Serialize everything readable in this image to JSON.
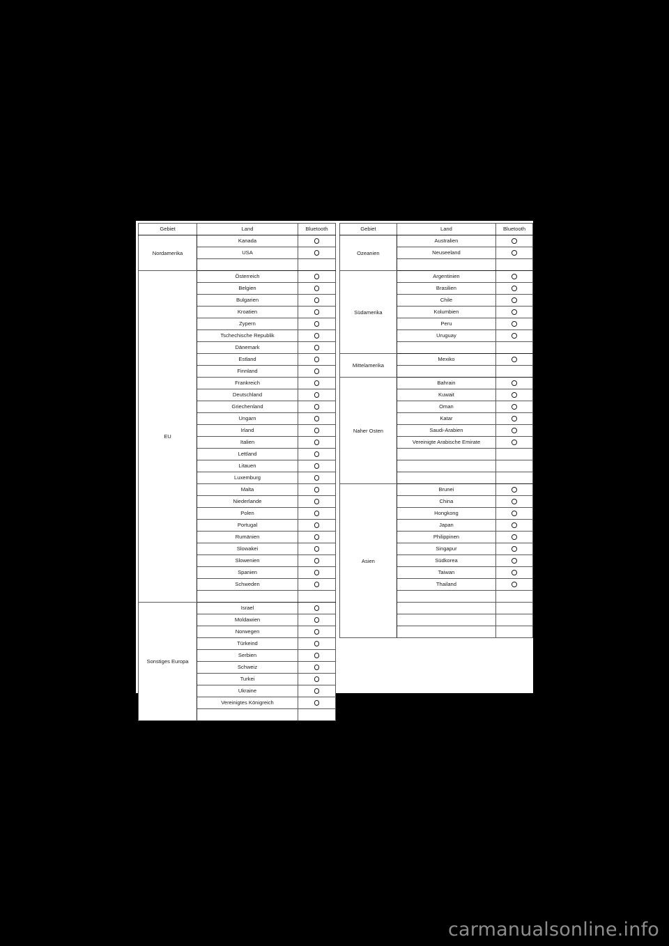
{
  "document": {
    "watermark": "carmanualsonline.info",
    "background_color": "#000000",
    "page_color": "#ffffff",
    "rule_color": "#1a1a1a"
  },
  "tables": [
    {
      "id": "left",
      "headers": [
        "Gebiet",
        "Land",
        "Bluetooth"
      ],
      "groups": [
        {
          "region": "Nordamerika",
          "rows": [
            {
              "country": "Kanada",
              "bluetooth": "O"
            },
            {
              "country": "USA",
              "bluetooth": "O"
            },
            {
              "country": "",
              "bluetooth": ""
            }
          ]
        },
        {
          "region": "EU",
          "rows": [
            {
              "country": "Österreich",
              "bluetooth": "O"
            },
            {
              "country": "Belgien",
              "bluetooth": "O"
            },
            {
              "country": "Bulgarien",
              "bluetooth": "O"
            },
            {
              "country": "Kroatien",
              "bluetooth": "O"
            },
            {
              "country": "Zypern",
              "bluetooth": "O"
            },
            {
              "country": "Tschechische Republik",
              "bluetooth": "O"
            },
            {
              "country": "Dänemark",
              "bluetooth": "O"
            },
            {
              "country": "Estland",
              "bluetooth": "O"
            },
            {
              "country": "Finnland",
              "bluetooth": "O"
            },
            {
              "country": "Frankreich",
              "bluetooth": "O"
            },
            {
              "country": "Deutschland",
              "bluetooth": "O"
            },
            {
              "country": "Griechenland",
              "bluetooth": "O"
            },
            {
              "country": "Ungarn",
              "bluetooth": "O"
            },
            {
              "country": "Irland",
              "bluetooth": "O"
            },
            {
              "country": "Italien",
              "bluetooth": "O"
            },
            {
              "country": "Lettland",
              "bluetooth": "O"
            },
            {
              "country": "Litauen",
              "bluetooth": "O"
            },
            {
              "country": "Luxemburg",
              "bluetooth": "O"
            },
            {
              "country": "Malta",
              "bluetooth": "O"
            },
            {
              "country": "Niederlande",
              "bluetooth": "O"
            },
            {
              "country": "Polen",
              "bluetooth": "O"
            },
            {
              "country": "Portugal",
              "bluetooth": "O"
            },
            {
              "country": "Rumänien",
              "bluetooth": "O"
            },
            {
              "country": "Slowakei",
              "bluetooth": "O"
            },
            {
              "country": "Slowenien",
              "bluetooth": "O"
            },
            {
              "country": "Spanien",
              "bluetooth": "O"
            },
            {
              "country": "Schweden",
              "bluetooth": "O"
            },
            {
              "country": "",
              "bluetooth": ""
            }
          ]
        },
        {
          "region": "Sonstiges Europa",
          "rows": [
            {
              "country": "Israel",
              "bluetooth": "O"
            },
            {
              "country": "Moldawien",
              "bluetooth": "O"
            },
            {
              "country": "Norwegen",
              "bluetooth": "O"
            },
            {
              "country": "Türkeind",
              "bluetooth": "O"
            },
            {
              "country": "Serbien",
              "bluetooth": "O"
            },
            {
              "country": "Schweiz",
              "bluetooth": "O"
            },
            {
              "country": "Turkei",
              "bluetooth": "O"
            },
            {
              "country": "Ukraine",
              "bluetooth": "O"
            },
            {
              "country": "Vereinigtes Königreich",
              "bluetooth": "O"
            },
            {
              "country": "",
              "bluetooth": ""
            }
          ]
        }
      ]
    },
    {
      "id": "right",
      "headers": [
        "Gebiet",
        "Land",
        "Bluetooth"
      ],
      "groups": [
        {
          "region": "Ozeanien",
          "rows": [
            {
              "country": "Australien",
              "bluetooth": "O"
            },
            {
              "country": "Neuseeland",
              "bluetooth": "O"
            },
            {
              "country": "",
              "bluetooth": ""
            }
          ]
        },
        {
          "region": "Südamerika",
          "rows": [
            {
              "country": "Argentinien",
              "bluetooth": "O"
            },
            {
              "country": "Brasilien",
              "bluetooth": "O"
            },
            {
              "country": "Chile",
              "bluetooth": "O"
            },
            {
              "country": "Kolumbien",
              "bluetooth": "O"
            },
            {
              "country": "Peru",
              "bluetooth": "O"
            },
            {
              "country": "Uruguay",
              "bluetooth": "O"
            },
            {
              "country": "",
              "bluetooth": ""
            }
          ]
        },
        {
          "region": "Mittelamerika",
          "rows": [
            {
              "country": "Mexiko",
              "bluetooth": "O"
            },
            {
              "country": "",
              "bluetooth": ""
            }
          ]
        },
        {
          "region": "Naher Osten",
          "rows": [
            {
              "country": "Bahrain",
              "bluetooth": "O"
            },
            {
              "country": "Kuwait",
              "bluetooth": "O"
            },
            {
              "country": "Oman",
              "bluetooth": "O"
            },
            {
              "country": "Katar",
              "bluetooth": "O"
            },
            {
              "country": "Saudi-Arabien",
              "bluetooth": "O"
            },
            {
              "country": "Vereinigte Arabische Emirate",
              "bluetooth": "O"
            },
            {
              "country": "",
              "bluetooth": ""
            },
            {
              "country": "",
              "bluetooth": ""
            },
            {
              "country": "",
              "bluetooth": ""
            }
          ]
        },
        {
          "region": "Asien",
          "rows": [
            {
              "country": "Brunei",
              "bluetooth": "O"
            },
            {
              "country": "China",
              "bluetooth": "O"
            },
            {
              "country": "Hongkong",
              "bluetooth": "O"
            },
            {
              "country": "Japan",
              "bluetooth": "O"
            },
            {
              "country": "Philippinen",
              "bluetooth": "O"
            },
            {
              "country": "Singapur",
              "bluetooth": "O"
            },
            {
              "country": "Südkorea",
              "bluetooth": "O"
            },
            {
              "country": "Taiwan",
              "bluetooth": "O"
            },
            {
              "country": "Thailand",
              "bluetooth": "O"
            },
            {
              "country": "",
              "bluetooth": ""
            },
            {
              "country": "",
              "bluetooth": ""
            },
            {
              "country": "",
              "bluetooth": ""
            },
            {
              "country": "",
              "bluetooth": ""
            }
          ]
        }
      ]
    }
  ]
}
